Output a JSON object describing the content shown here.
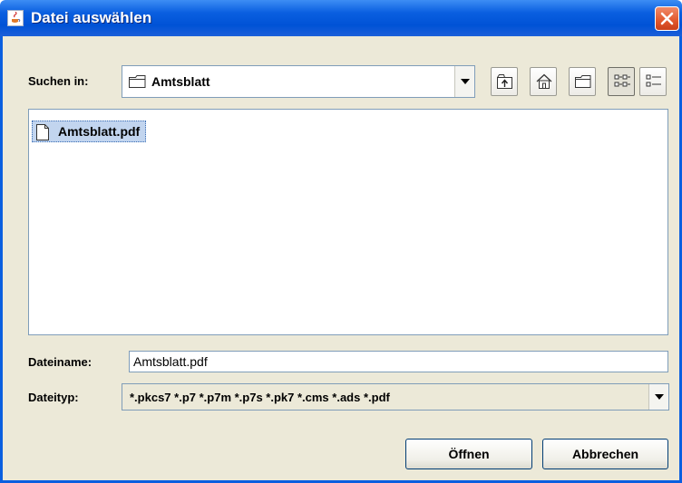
{
  "window": {
    "title": "Datei auswählen",
    "icon": "java-cup-icon",
    "close_icon": "close-icon"
  },
  "lookin": {
    "label": "Suchen in:",
    "value": "Amtsblatt",
    "icon": "folder-icon"
  },
  "toolbar": {
    "buttons": [
      {
        "name": "up-one-level-icon"
      },
      {
        "name": "home-icon"
      },
      {
        "name": "new-folder-icon"
      },
      {
        "name": "list-view-icon",
        "pressed": true
      },
      {
        "name": "details-view-icon"
      }
    ]
  },
  "files": [
    {
      "name": "Amtsblatt.pdf",
      "selected": true,
      "icon": "file-icon"
    }
  ],
  "filename": {
    "label": "Dateiname:",
    "value": "Amtsblatt.pdf"
  },
  "filetype": {
    "label": "Dateityp:",
    "value": "*.pkcs7 *.p7 *.p7m *.p7s *.pk7 *.cms *.ads *.pdf"
  },
  "buttons": {
    "open": "Öffnen",
    "cancel": "Abbrechen"
  },
  "colors": {
    "titlebar": "#0a5fe0",
    "panel": "#ece9d8",
    "selection": "#c2d5ef",
    "close": "#e2572c"
  }
}
